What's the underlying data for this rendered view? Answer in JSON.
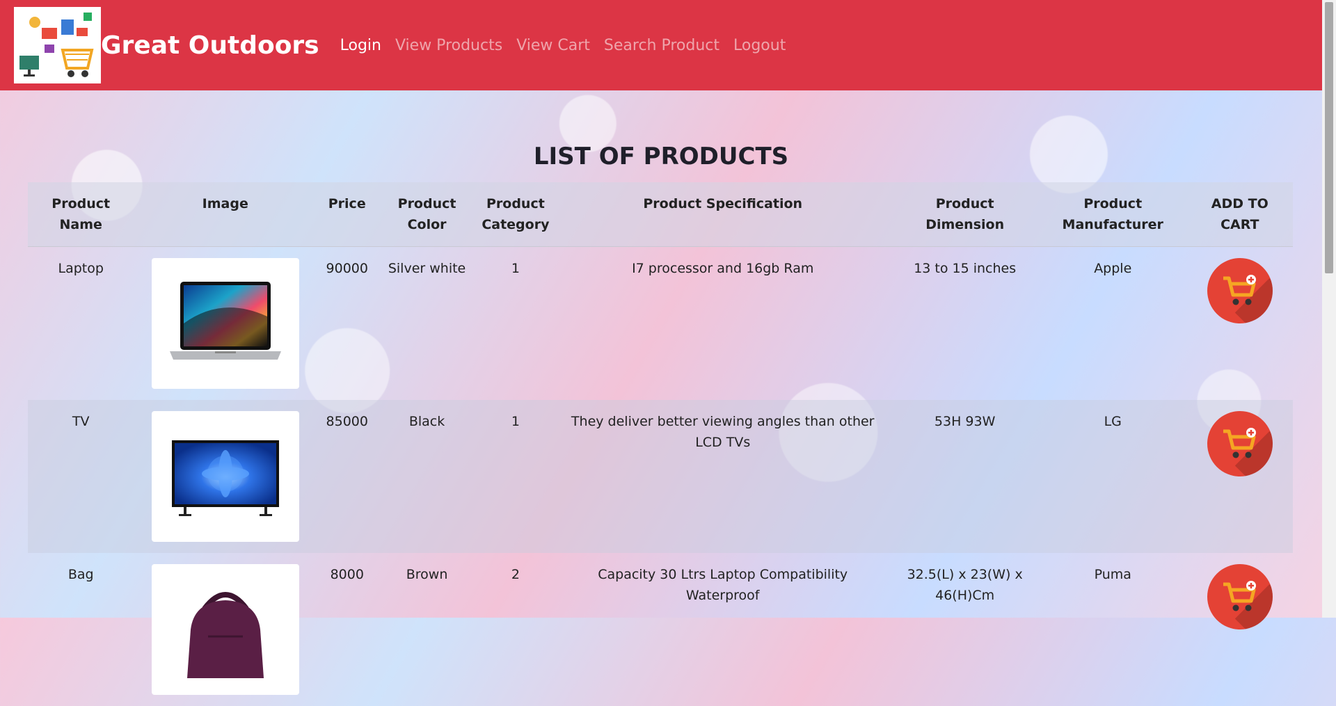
{
  "navbar": {
    "brand": "Great Outdoors",
    "links": [
      {
        "label": "Login",
        "active": true
      },
      {
        "label": "View Products",
        "active": false
      },
      {
        "label": "View Cart",
        "active": false
      },
      {
        "label": "Search Product",
        "active": false
      },
      {
        "label": "Logout",
        "active": false
      }
    ]
  },
  "main": {
    "title": "LIST OF PRODUCTS",
    "columns": [
      "Product Name",
      "Image",
      "Price",
      "Product Color",
      "Product Category",
      "Product Specification",
      "Product Dimension",
      "Product Manufacturer",
      "ADD TO CART"
    ],
    "rows": [
      {
        "name": "Laptop",
        "image_icon": "laptop-image",
        "price": "90000",
        "color": "Silver white",
        "category": "1",
        "spec": "I7 processor and 16gb Ram",
        "dimension": "13 to 15 inches",
        "manufacturer": "Apple"
      },
      {
        "name": "TV",
        "image_icon": "tv-image",
        "price": "85000",
        "color": "Black",
        "category": "1",
        "spec": "They deliver better viewing angles than other LCD TVs",
        "dimension": "53H 93W",
        "manufacturer": "LG"
      },
      {
        "name": "Bag",
        "image_icon": "bag-image",
        "price": "8000",
        "color": "Brown",
        "category": "2",
        "spec": "Capacity 30 Ltrs Laptop Compatibility Waterproof",
        "dimension": "32.5(L) x 23(W) x 46(H)Cm",
        "manufacturer": "Puma"
      }
    ]
  },
  "colors": {
    "navbar": "#dc3545",
    "cart_button": "#e44235",
    "cart_icon": "#f5a623"
  }
}
